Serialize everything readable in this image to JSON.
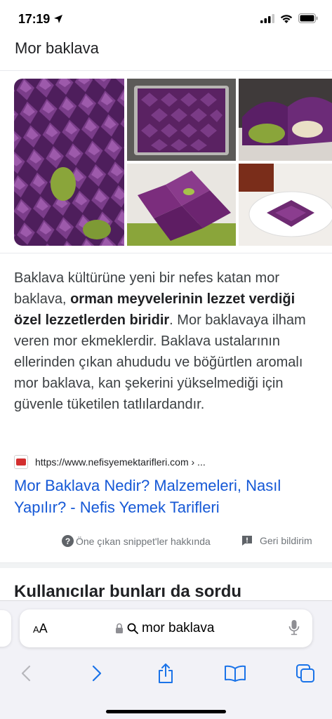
{
  "status": {
    "time": "17:19"
  },
  "title": "Mor baklava",
  "snippet": {
    "part1": "Baklava kültürüne yeni bir nefes katan mor baklava, ",
    "bold": "orman meyvelerinin lezzet verdiği özel lezzetlerden biridir",
    "part2": ". Mor baklavaya ilham veren mor ekmeklerdir. Baklava ustalarının ellerinden çıkan ahududu ve böğürtlen aromalı mor baklava, kan şekerini yükselmediği için güvenle tüketilen tatlılardandır."
  },
  "source": {
    "url": "https://www.nefisyemektarifleri.com › ..."
  },
  "result": {
    "title": "Mor Baklava Nedir? Malzemeleri, Nasıl Yapılır? - Nefis Yemek Tarifleri"
  },
  "footer": {
    "about": "Öne çıkan snippet'ler hakkında",
    "feedback": "Geri bildirim"
  },
  "people_also_ask": "Kullanıcılar bunları da sordu",
  "browser": {
    "aa_small": "A",
    "aa_large": "A",
    "address": "mor baklava"
  },
  "colors": {
    "link": "#1558d6",
    "purple": "#6b2c74",
    "pistachio": "#8aa53a"
  }
}
